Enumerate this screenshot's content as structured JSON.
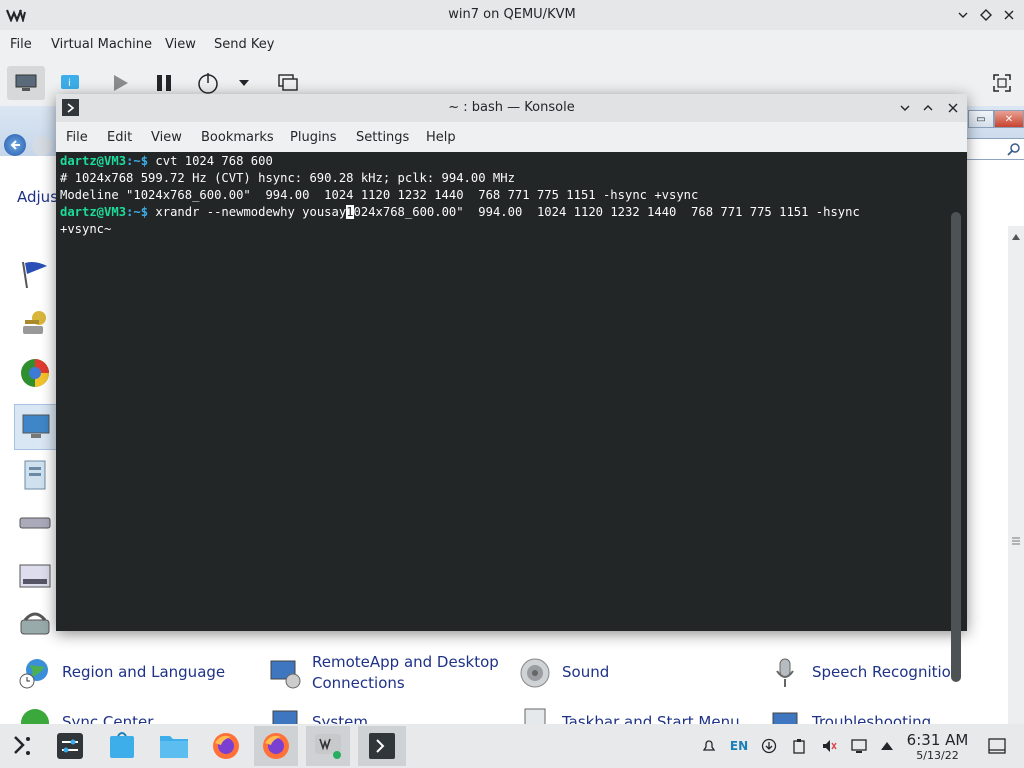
{
  "vm_window": {
    "title": "win7 on QEMU/KVM",
    "menu": [
      "File",
      "Virtual Machine",
      "View",
      "Send Key"
    ]
  },
  "guest": {
    "partial_heading": "Adjus",
    "control_panel_items": [
      {
        "label": "Region and Language",
        "icon": "globe-clock-icon"
      },
      {
        "label": "RemoteApp and Desktop Connections",
        "icon": "remote-desktop-icon"
      },
      {
        "label": "Sound",
        "icon": "speaker-icon"
      },
      {
        "label": "Speech Recognition",
        "icon": "microphone-icon"
      },
      {
        "label": "Sync Center",
        "icon": "sync-icon"
      },
      {
        "label": "System",
        "icon": "system-icon"
      },
      {
        "label": "Taskbar and Start Menu",
        "icon": "taskbar-icon"
      },
      {
        "label": "Troubleshooting",
        "icon": "troubleshooting-icon"
      }
    ]
  },
  "konsole": {
    "title": "~ : bash — Konsole",
    "menu": [
      "File",
      "Edit",
      "View",
      "Bookmarks",
      "Plugins",
      "Settings",
      "Help"
    ],
    "prompt_user": "dartz@VM3",
    "prompt_path": ":~$",
    "lines": {
      "cmd1": " cvt 1024 768 600",
      "out1": "# 1024x768 599.72 Hz (CVT) hsync: 690.28 kHz; pclk: 994.00 MHz",
      "out2": "Modeline \"1024x768_600.00\"  994.00  1024 1120 1232 1440  768 771 775 1151 -hsync +vsync",
      "cmd2_before_cursor": " xrandr --newmodewhy yousay",
      "cmd2_cursor_char": "1",
      "cmd2_after_cursor": "024x768_600.00\"  994.00  1024 1120 1232 1440  768 771 775 1151 -hsync",
      "cmd2_wrap": "+vsync~"
    }
  },
  "taskbar": {
    "language": "EN",
    "time": "6:31 AM",
    "date": "5/13/22"
  },
  "colors": {
    "terminal_bg": "#232627",
    "prompt_user": "#1cdc9a",
    "prompt_path": "#3daee9",
    "link_blue": "#1e3287"
  }
}
